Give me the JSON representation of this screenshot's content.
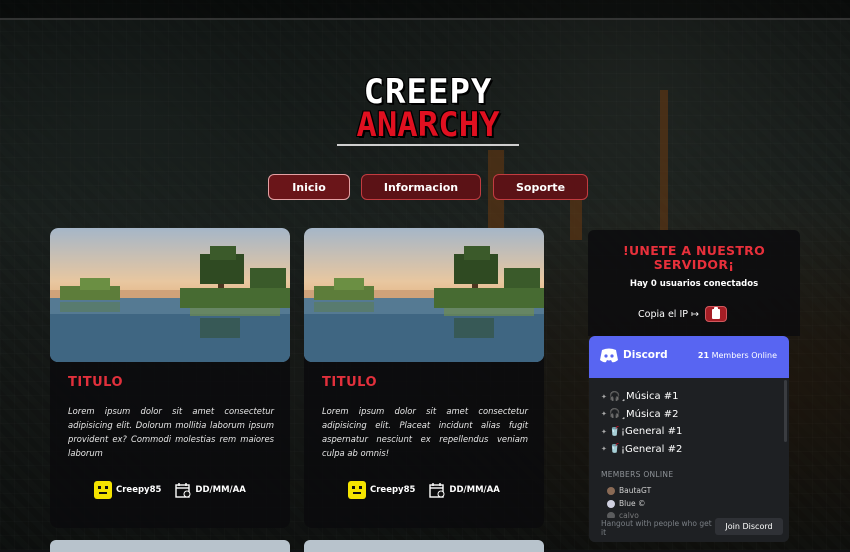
{
  "logo": {
    "line1": "CREEPY",
    "line2": "ANARCHY"
  },
  "nav": [
    {
      "label": "Inicio",
      "active": true
    },
    {
      "label": "Informacion",
      "active": false
    },
    {
      "label": "Soporte",
      "active": false
    }
  ],
  "cards": [
    {
      "title": "TITULO",
      "text": "Lorem ipsum dolor sit amet consectetur adipisicing elit. Dolorum mollitia laborum ipsum provident ex? Commodi molestias rem maiores laborum",
      "author": "Creepy85",
      "date": "DD/MM/AA"
    },
    {
      "title": "TITULO",
      "text": "Lorem ipsum dolor sit amet consectetur adipisicing elit. Placeat incidunt alias fugit aspernatur nesciunt ex repellendus veniam culpa ab omnis!",
      "author": "Creepy85",
      "date": "DD/MM/AA"
    }
  ],
  "server_panel": {
    "title_line1": "!UNETE A NUESTRO",
    "title_line2": "SERVIDOR¡",
    "subtitle": "Hay 0 usuarios conectados",
    "copy_label": "Copia el IP ↦"
  },
  "discord": {
    "brand": "Discord",
    "members_count": "21",
    "members_label": "Members Online",
    "channels": [
      {
        "icon": "headphones-icon",
        "symbol": "🎧",
        "name": "¸Música #1"
      },
      {
        "icon": "headphones-icon",
        "symbol": "🎧",
        "name": "¸Música #2"
      },
      {
        "icon": "cup-icon",
        "symbol": "🥤",
        "name": "¡General #1"
      },
      {
        "icon": "cup-icon",
        "symbol": "🥤",
        "name": "¡General #2"
      }
    ],
    "members_heading": "MEMBERS ONLINE",
    "members": [
      {
        "name": "BautaGT",
        "color": "#8a6a55"
      },
      {
        "name": "Blue ©",
        "color": "#d0d0e0"
      },
      {
        "name": "calvo",
        "color": "#999999"
      }
    ],
    "footer_text": "Hangout with people who get it",
    "join_label": "Join Discord",
    "accent": "#5865f2"
  },
  "colors": {
    "accent_red": "#e2303c",
    "nav_bg": "#5b1216",
    "copy_button": "#a51e25"
  }
}
